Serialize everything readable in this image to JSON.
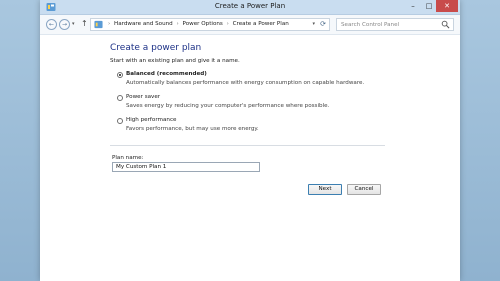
{
  "window": {
    "title": "Create a Power Plan",
    "controls": {
      "minimize": "–",
      "maximize": "□",
      "close": "✕"
    }
  },
  "nav": {
    "back_glyph": "←",
    "forward_glyph": "→",
    "recent_glyph": "▾",
    "up_glyph": "↑",
    "breadcrumbs": [
      "Hardware and Sound",
      "Power Options",
      "Create a Power Plan"
    ],
    "separator": "›",
    "dropdown_glyph": "▾",
    "refresh_glyph": "⟳"
  },
  "search": {
    "placeholder": "Search Control Panel"
  },
  "page": {
    "heading": "Create a power plan",
    "intro": "Start with an existing plan and give it a name.",
    "options": [
      {
        "label": "Balanced (recommended)",
        "description": "Automatically balances performance with energy consumption on capable hardware.",
        "selected": true
      },
      {
        "label": "Power saver",
        "description": "Saves energy by reducing your computer's performance where possible.",
        "selected": false
      },
      {
        "label": "High performance",
        "description": "Favors performance, but may use more energy.",
        "selected": false
      }
    ],
    "plan_name_label": "Plan name:",
    "plan_name_value": "My Custom Plan 1"
  },
  "buttons": {
    "next": "Next",
    "cancel": "Cancel"
  },
  "colors": {
    "heading": "#1e3287",
    "titlebar": "#c9ddf0",
    "desktop": "#9fbfda"
  }
}
